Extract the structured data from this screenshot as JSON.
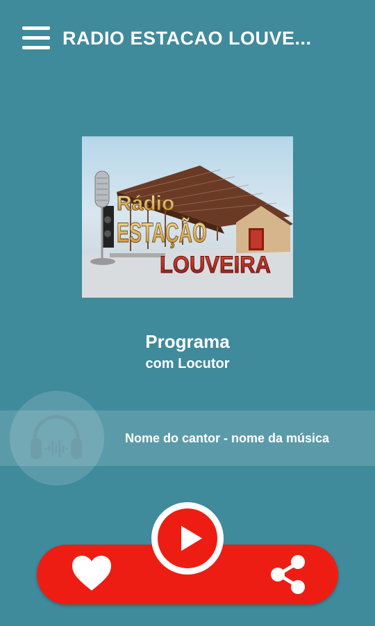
{
  "app_bar": {
    "title": "RADIO ESTACAO LOUVE...",
    "menu_icon": "hamburger-menu-icon"
  },
  "artwork": {
    "logo_line1": "Rádio",
    "logo_line2": "ESTAÇÃO",
    "logo_line3": "LOUVEIRA"
  },
  "program": {
    "name": "Programa",
    "host": "com Locutor"
  },
  "now_playing": {
    "icon": "headphones-icon",
    "song": "Nome do cantor - nome da música"
  },
  "controls": {
    "favorite_icon": "heart-icon",
    "play_icon": "play-icon",
    "share_icon": "share-icon"
  },
  "colors": {
    "background": "#3f8a9b",
    "accent": "#ee1d13",
    "text": "#ffffff"
  }
}
